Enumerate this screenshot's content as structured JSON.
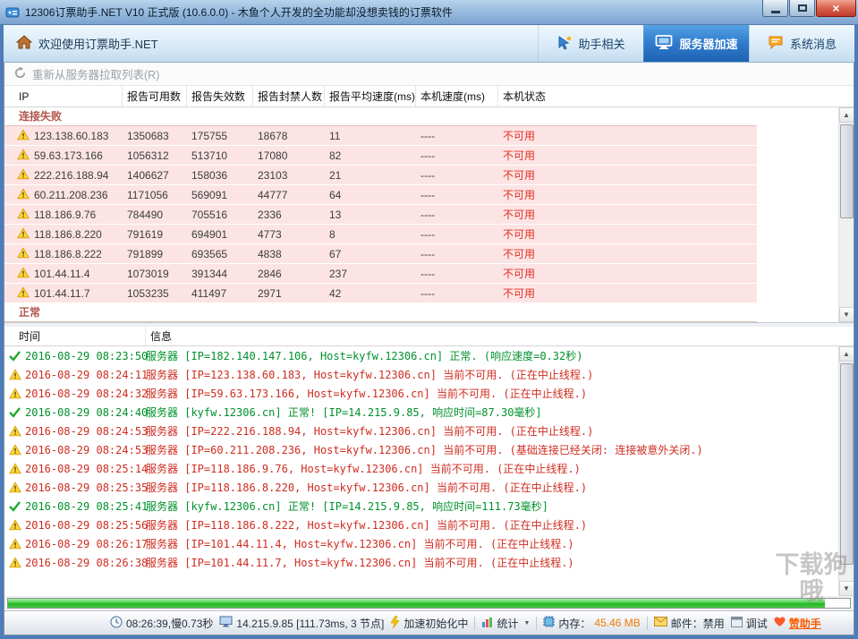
{
  "window": {
    "title": "12306订票助手.NET V10 正式版 (10.6.0.0) - 木鱼个人开发的全功能却没想卖钱的订票软件"
  },
  "navbar": {
    "welcome": "欢迎使用订票助手.NET",
    "tabs": [
      {
        "label": "助手相关",
        "active": false
      },
      {
        "label": "服务器加速",
        "active": true
      },
      {
        "label": "系统消息",
        "active": false
      }
    ]
  },
  "toolbar": {
    "refresh_label": "重新从服务器拉取列表(R)"
  },
  "server_table": {
    "columns": [
      "IP",
      "报告可用数",
      "报告失效数",
      "报告封禁人数",
      "报告平均速度(ms)",
      "本机速度(ms)",
      "本机状态"
    ],
    "groups": {
      "failed": "连接失败",
      "normal": "正常"
    },
    "rows": [
      {
        "ip": "123.138.60.183",
        "reported_ok": "1350683",
        "reported_fail": "175755",
        "reported_ban": "18678",
        "avg_speed": "11",
        "local_speed": "----",
        "local_status": "不可用"
      },
      {
        "ip": "59.63.173.166",
        "reported_ok": "1056312",
        "reported_fail": "513710",
        "reported_ban": "17080",
        "avg_speed": "82",
        "local_speed": "----",
        "local_status": "不可用"
      },
      {
        "ip": "222.216.188.94",
        "reported_ok": "1406627",
        "reported_fail": "158036",
        "reported_ban": "23103",
        "avg_speed": "21",
        "local_speed": "----",
        "local_status": "不可用"
      },
      {
        "ip": "60.211.208.236",
        "reported_ok": "1171056",
        "reported_fail": "569091",
        "reported_ban": "44777",
        "avg_speed": "64",
        "local_speed": "----",
        "local_status": "不可用"
      },
      {
        "ip": "118.186.9.76",
        "reported_ok": "784490",
        "reported_fail": "705516",
        "reported_ban": "2336",
        "avg_speed": "13",
        "local_speed": "----",
        "local_status": "不可用"
      },
      {
        "ip": "118.186.8.220",
        "reported_ok": "791619",
        "reported_fail": "694901",
        "reported_ban": "4773",
        "avg_speed": "8",
        "local_speed": "----",
        "local_status": "不可用"
      },
      {
        "ip": "118.186.8.222",
        "reported_ok": "791899",
        "reported_fail": "693565",
        "reported_ban": "4838",
        "avg_speed": "67",
        "local_speed": "----",
        "local_status": "不可用"
      },
      {
        "ip": "101.44.11.4",
        "reported_ok": "1073019",
        "reported_fail": "391344",
        "reported_ban": "2846",
        "avg_speed": "237",
        "local_speed": "----",
        "local_status": "不可用"
      },
      {
        "ip": "101.44.11.7",
        "reported_ok": "1053235",
        "reported_fail": "411497",
        "reported_ban": "2971",
        "avg_speed": "42",
        "local_speed": "----",
        "local_status": "不可用"
      }
    ]
  },
  "log_table": {
    "columns": [
      "时间",
      "信息"
    ],
    "rows": [
      {
        "type": "ok",
        "time": "2016-08-29 08:23:50",
        "message": "服务器 [IP=182.140.147.106, Host=kyfw.12306.cn] 正常. (响应速度=0.32秒)"
      },
      {
        "type": "warn",
        "time": "2016-08-29 08:24:11",
        "message": "服务器 [IP=123.138.60.183, Host=kyfw.12306.cn] 当前不可用. (正在中止线程.)"
      },
      {
        "type": "warn",
        "time": "2016-08-29 08:24:32",
        "message": "服务器 [IP=59.63.173.166, Host=kyfw.12306.cn] 当前不可用. (正在中止线程.)"
      },
      {
        "type": "ok",
        "time": "2016-08-29 08:24:40",
        "message": "服务器 [kyfw.12306.cn] 正常! [IP=14.215.9.85, 响应时间=87.30毫秒]"
      },
      {
        "type": "warn",
        "time": "2016-08-29 08:24:53",
        "message": "服务器 [IP=222.216.188.94, Host=kyfw.12306.cn] 当前不可用. (正在中止线程.)"
      },
      {
        "type": "warn",
        "time": "2016-08-29 08:24:53",
        "message": "服务器 [IP=60.211.208.236, Host=kyfw.12306.cn] 当前不可用. (基础连接已经关闭: 连接被意外关闭.)"
      },
      {
        "type": "warn",
        "time": "2016-08-29 08:25:14",
        "message": "服务器 [IP=118.186.9.76, Host=kyfw.12306.cn] 当前不可用. (正在中止线程.)"
      },
      {
        "type": "warn",
        "time": "2016-08-29 08:25:35",
        "message": "服务器 [IP=118.186.8.220, Host=kyfw.12306.cn] 当前不可用. (正在中止线程.)"
      },
      {
        "type": "ok",
        "time": "2016-08-29 08:25:41",
        "message": "服务器 [kyfw.12306.cn] 正常! [IP=14.215.9.85, 响应时间=111.73毫秒]"
      },
      {
        "type": "warn",
        "time": "2016-08-29 08:25:56",
        "message": "服务器 [IP=118.186.8.222, Host=kyfw.12306.cn] 当前不可用. (正在中止线程.)"
      },
      {
        "type": "warn",
        "time": "2016-08-29 08:26:17",
        "message": "服务器 [IP=101.44.11.4, Host=kyfw.12306.cn] 当前不可用. (正在中止线程.)"
      },
      {
        "type": "warn",
        "time": "2016-08-29 08:26:38",
        "message": "服务器 [IP=101.44.11.7, Host=kyfw.12306.cn] 当前不可用. (正在中止线程.)"
      }
    ]
  },
  "progress": {
    "percent": 97
  },
  "statusbar": {
    "time": "08:26:39,慢0.73秒",
    "server": "14.215.9.85 [111.73ms, 3 节点]",
    "accel": "加速初始化中",
    "stats": "统计",
    "memory_label": "内存：",
    "memory_value": "45.46 MB",
    "mail": "邮件：禁用",
    "debug": "调试",
    "sponsor": "赞助手"
  },
  "watermark": "下载狗哦"
}
